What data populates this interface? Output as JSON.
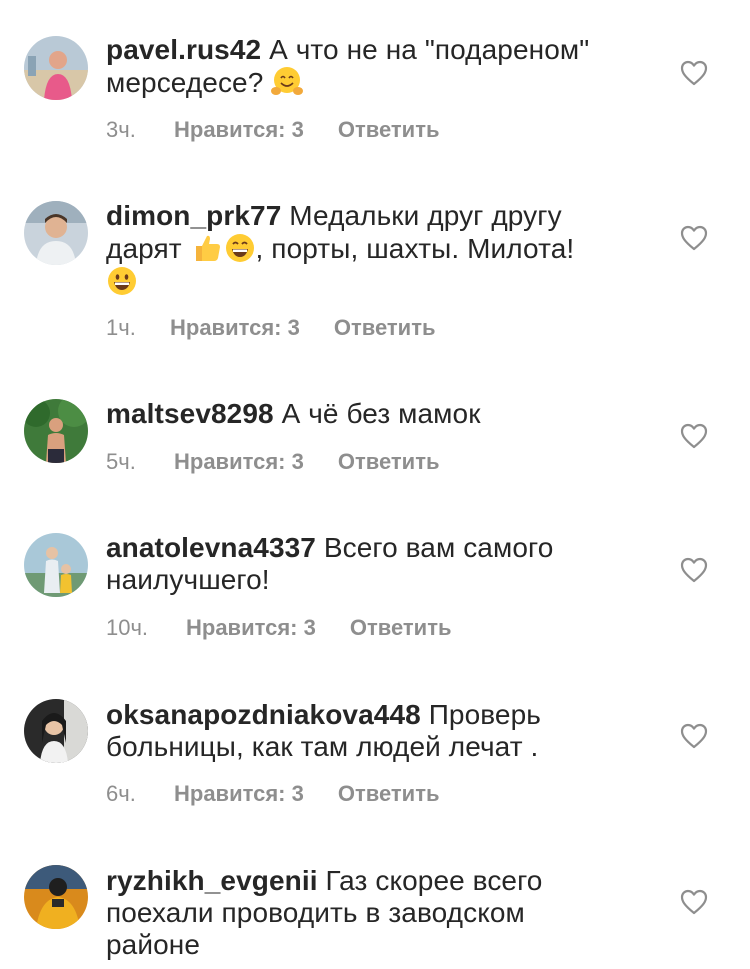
{
  "comments": [
    {
      "username": "pavel.rus42",
      "text": " А что не на \"подареном\"",
      "text2": "мерседесе? ",
      "time": "3ч.",
      "likes": "Нравится: 3",
      "reply": "Ответить",
      "emoji": "hugging-face"
    },
    {
      "username": "dimon_prk77",
      "text": " Медальки друг другу",
      "text2a": "дарят ",
      "text2b": ", порты, шахты. Милота!",
      "time": "1ч.",
      "likes": "Нравится: 3",
      "reply": "Ответить",
      "emoji": [
        "thumbs-up",
        "grinning-face",
        "grinning-face"
      ]
    },
    {
      "username": "maltsev8298",
      "text": " А чё без мамок",
      "time": "5ч.",
      "likes": "Нравится: 3",
      "reply": "Ответить"
    },
    {
      "username": "anatolevna4337",
      "text": " Всего вам самого",
      "text2": "наилучшего!",
      "time": "10ч.",
      "likes": "Нравится: 3",
      "reply": "Ответить"
    },
    {
      "username": "oksanapozdniakova448",
      "text": " Проверь",
      "text2": "больницы, как там людей лечат .",
      "time": "6ч.",
      "likes": "Нравится: 3",
      "reply": "Ответить"
    },
    {
      "username": "ryzhikh_evgenii",
      "text": " Газ скорее всего",
      "text2": "поехали проводить в заводском",
      "text3": "районе"
    }
  ],
  "colors": {
    "text": "#262626",
    "meta": "#8e8e8e",
    "heart": "#8e8e8e"
  }
}
